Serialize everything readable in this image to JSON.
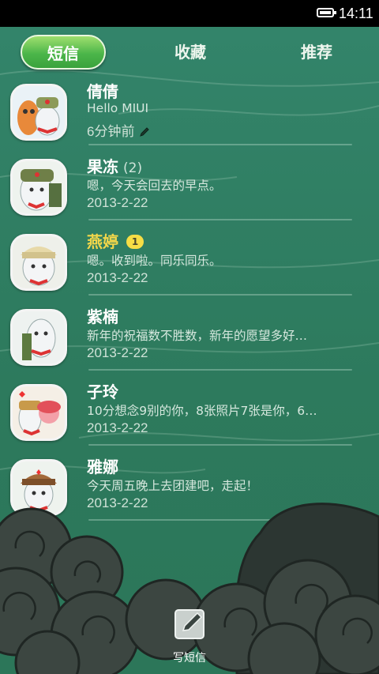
{
  "status_bar": {
    "time": "14:11",
    "battery_icon": "battery-full-icon"
  },
  "tabs": [
    {
      "label": "短信",
      "active": true
    },
    {
      "label": "收藏",
      "active": false
    },
    {
      "label": "推荐",
      "active": false
    }
  ],
  "conversations": [
    {
      "name": "倩倩",
      "count": "",
      "badge": "",
      "snippet": "Hello MIUI",
      "date": "6分钟前",
      "draft": true,
      "unread": false
    },
    {
      "name": "果冻",
      "count": "(2)",
      "badge": "",
      "snippet": "嗯，今天会回去的早点。",
      "date": "2013-2-22",
      "draft": false,
      "unread": false
    },
    {
      "name": "燕婷",
      "count": "",
      "badge": "1",
      "snippet": "嗯。收到啦。同乐同乐。",
      "date": "2013-2-22",
      "draft": false,
      "unread": true
    },
    {
      "name": "紫楠",
      "count": "",
      "badge": "",
      "snippet": "新年的祝福数不胜数，新年的愿望多好…",
      "date": "2013-2-22",
      "draft": false,
      "unread": false
    },
    {
      "name": "子玲",
      "count": "",
      "badge": "",
      "snippet": "10分想念9别的你，8张照片7张是你，6…",
      "date": "2013-2-22",
      "draft": false,
      "unread": false
    },
    {
      "name": "雅娜",
      "count": "",
      "badge": "",
      "snippet": "今天周五晚上去团建吧，走起！",
      "date": "2013-2-22",
      "draft": false,
      "unread": false
    }
  ],
  "compose": {
    "label": "写短信",
    "icon": "compose-icon"
  },
  "colors": {
    "board": "#2e7a5c",
    "active_tab": "#4cb64a",
    "unread_name": "#f2d64a",
    "badge": "#f6dd45"
  }
}
